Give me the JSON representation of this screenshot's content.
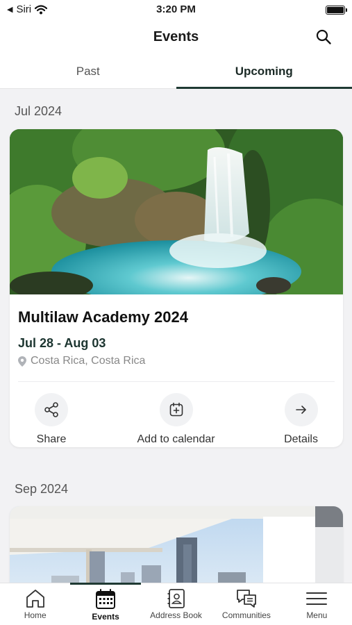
{
  "status": {
    "carrier": "Siri",
    "time": "3:20 PM"
  },
  "header": {
    "title": "Events"
  },
  "tabs": [
    {
      "label": "Past",
      "active": false
    },
    {
      "label": "Upcoming",
      "active": true
    }
  ],
  "sections": [
    {
      "month": "Jul 2024",
      "event": {
        "title": "Multilaw Academy 2024",
        "dates": "Jul 28 - Aug 03",
        "location": "Costa Rica, Costa Rica",
        "image": "waterfall-jungle"
      },
      "actions": {
        "share": "Share",
        "calendar": "Add to calendar",
        "details": "Details"
      }
    },
    {
      "month": "Sep 2024",
      "event": {
        "image": "city-skyline-terrace"
      }
    }
  ],
  "bottom_nav": [
    {
      "label": "Home",
      "icon": "home-icon",
      "active": false
    },
    {
      "label": "Events",
      "icon": "calendar-icon",
      "active": true
    },
    {
      "label": "Address Book",
      "icon": "address-book-icon",
      "active": false
    },
    {
      "label": "Communities",
      "icon": "chat-bubbles-icon",
      "active": false
    },
    {
      "label": "Menu",
      "icon": "hamburger-icon",
      "active": false
    }
  ],
  "colors": {
    "accent": "#1f3a33",
    "background": "#f2f2f4"
  }
}
